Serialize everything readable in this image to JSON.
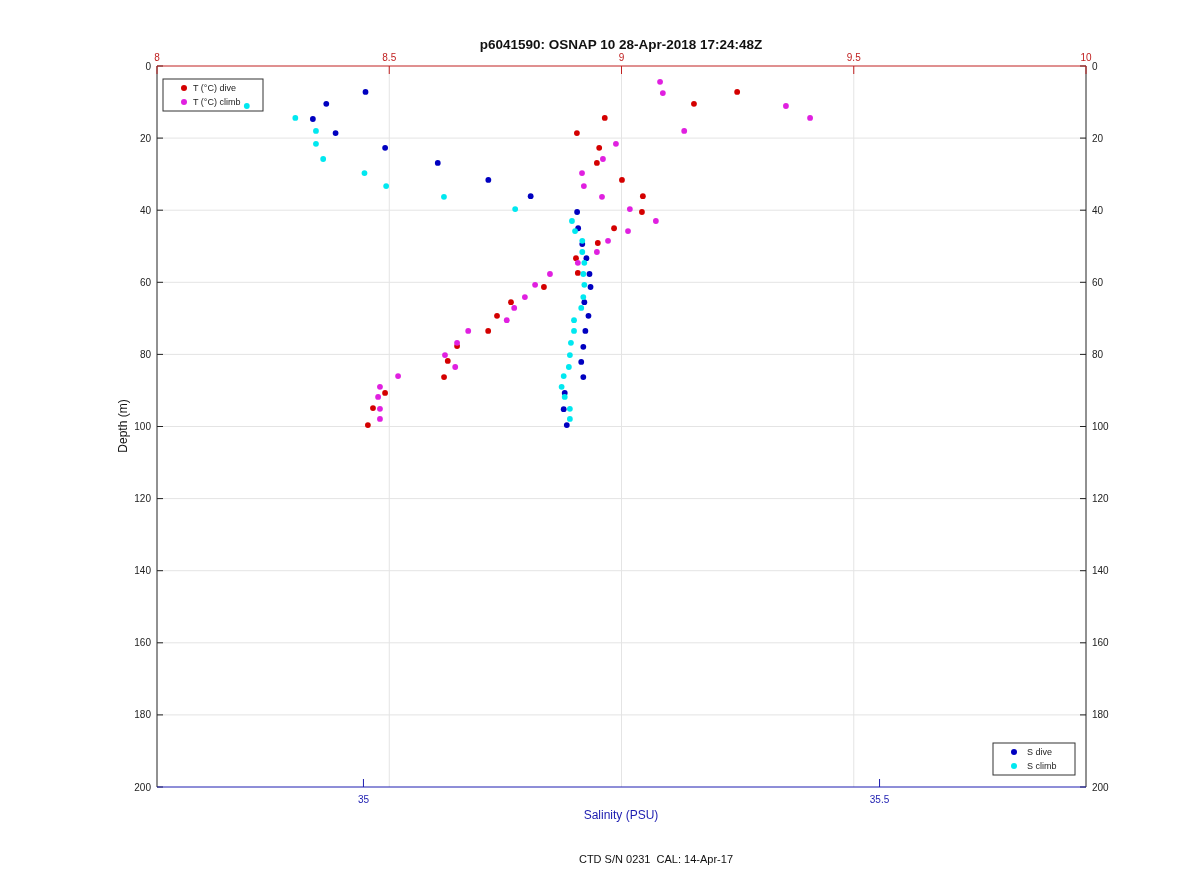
{
  "chart_data": {
    "type": "scatter",
    "title": "p6041590: OSNAP 10 28-Apr-2018 17:24:48Z",
    "xlabel": "Salinity (PSU)",
    "ylabel": "Depth (m)",
    "xlim": [
      34.8,
      35.7
    ],
    "ylim": [
      200,
      0
    ],
    "xticks": [
      35,
      35.5
    ],
    "yticks": [
      0,
      20,
      40,
      60,
      80,
      100,
      120,
      140,
      160,
      180,
      200
    ],
    "x2lim": [
      8,
      10
    ],
    "x2ticks": [
      8,
      8.5,
      9,
      9.5,
      10
    ],
    "grid": true,
    "legend": "upper left",
    "y2lim": [
      200,
      0
    ],
    "y2ticks": [
      0,
      20,
      40,
      60,
      80,
      100,
      120,
      140,
      160,
      180,
      200
    ],
    "series": [
      {
        "name": "T (°C) dive",
        "color": "#d40000",
        "axis": "x2",
        "x": [
          9.249,
          9.156,
          8.964,
          8.904,
          8.952,
          8.947,
          9.001,
          9.046,
          9.044,
          8.984,
          8.949,
          8.902,
          8.906,
          8.833,
          8.762,
          8.732,
          8.713,
          8.646,
          8.626,
          8.618,
          8.491,
          8.465,
          8.454
        ],
        "values": [
          7.2,
          10.5,
          14.4,
          18.6,
          22.7,
          26.9,
          31.6,
          36.1,
          40.5,
          45.0,
          49.1,
          53.3,
          57.4,
          61.3,
          65.5,
          69.3,
          73.5,
          77.7,
          81.8,
          86.3,
          90.7,
          94.9,
          99.6
        ]
      },
      {
        "name": "T (°C) climb",
        "color": "#e020e0",
        "axis": "x2",
        "x": [
          9.083,
          9.089,
          9.354,
          9.406,
          9.135,
          8.988,
          8.96,
          8.915,
          8.919,
          8.958,
          9.018,
          9.074,
          9.014,
          8.971,
          8.947,
          8.906,
          8.846,
          8.814,
          8.792,
          8.769,
          8.753,
          8.67,
          8.646,
          8.62,
          8.642,
          8.519,
          8.48,
          8.476,
          8.48,
          8.48
        ],
        "values": [
          4.4,
          7.5,
          11.1,
          14.4,
          18.0,
          21.6,
          25.8,
          29.7,
          33.3,
          36.3,
          39.7,
          43.0,
          45.8,
          48.5,
          51.6,
          54.6,
          57.7,
          60.7,
          64.1,
          67.1,
          70.5,
          73.5,
          76.8,
          80.2,
          83.5,
          86.0,
          89.0,
          91.8,
          95.1,
          97.9
        ]
      },
      {
        "name": "S dive",
        "color": "#0000c0",
        "x": [
          35.002,
          34.964,
          34.951,
          34.973,
          35.021,
          35.072,
          35.121,
          35.162,
          35.207,
          35.208,
          35.212,
          35.216,
          35.219,
          35.22,
          35.214,
          35.218,
          35.215,
          35.213,
          35.211,
          35.213,
          35.195,
          35.194,
          35.197
        ],
        "values": [
          7.2,
          10.5,
          14.7,
          18.6,
          22.7,
          26.9,
          31.6,
          36.1,
          40.5,
          45.0,
          49.4,
          53.3,
          57.7,
          61.3,
          65.5,
          69.3,
          73.5,
          77.9,
          82.1,
          86.3,
          90.7,
          95.2,
          99.6
        ]
      },
      {
        "name": "S climb",
        "color": "#00e8f0",
        "x": [
          34.887,
          34.934,
          34.954,
          34.954,
          34.961,
          35.001,
          35.022,
          35.078,
          35.147,
          35.202,
          35.205,
          35.212,
          35.212,
          35.214,
          35.213,
          35.214,
          35.213,
          35.211,
          35.204,
          35.204,
          35.201,
          35.2,
          35.199,
          35.194,
          35.192,
          35.195,
          35.2,
          35.2
        ],
        "values": [
          11.1,
          14.4,
          18.0,
          21.6,
          25.8,
          29.7,
          33.3,
          36.3,
          39.7,
          43.0,
          45.8,
          48.5,
          51.6,
          54.6,
          57.7,
          60.7,
          64.1,
          67.1,
          70.5,
          73.5,
          76.8,
          80.2,
          83.5,
          86.0,
          89.0,
          91.8,
          95.1,
          97.9
        ]
      }
    ]
  },
  "footer": "CTD S/N 0231  CAL: 14-Apr-17"
}
